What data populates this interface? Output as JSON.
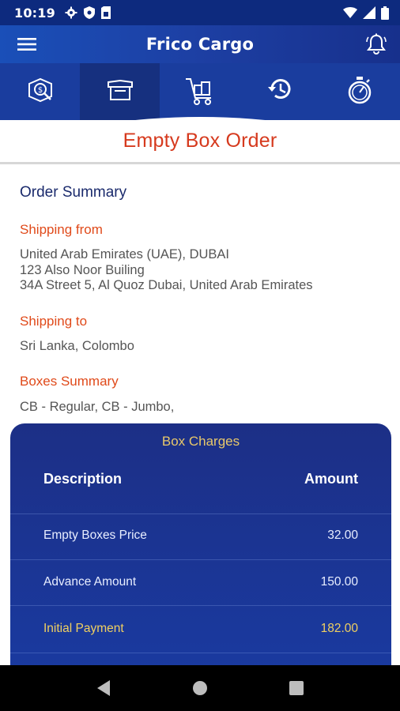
{
  "status_bar": {
    "time": "10:19",
    "icons": [
      "gear-icon",
      "shield-icon",
      "sim-card-icon",
      "wifi-icon",
      "signal-icon",
      "battery-icon"
    ]
  },
  "app_bar": {
    "title": "Frico Cargo",
    "menu_icon": "hamburger-menu-icon",
    "notification_icon": "bell-icon"
  },
  "tabs": [
    {
      "icon": "track-parcel-icon",
      "active": false
    },
    {
      "icon": "empty-box-icon",
      "active": true
    },
    {
      "icon": "cart-boxes-icon",
      "active": false
    },
    {
      "icon": "history-icon",
      "active": false
    },
    {
      "icon": "stopwatch-icon",
      "active": false
    }
  ],
  "page": {
    "title": "Empty Box Order"
  },
  "order_summary": {
    "heading": "Order Summary",
    "shipping_from_label": "Shipping from",
    "shipping_from_line1": "United Arab Emirates (UAE), DUBAI",
    "shipping_from_line2": "123 Also Noor Builing",
    "shipping_from_line3": "34A Street 5, Al Quoz Dubai, United Arab Emirates",
    "shipping_to_label": "Shipping to",
    "shipping_to_value": "Sri Lanka, Colombo",
    "boxes_summary_label": "Boxes Summary",
    "boxes_summary_value": "CB - Regular, CB - Jumbo,"
  },
  "box_charges": {
    "title": "Box Charges",
    "col_description": "Description",
    "col_amount": "Amount",
    "rows": [
      {
        "description": "Empty Boxes Price",
        "amount": "32.00",
        "highlight": false
      },
      {
        "description": "Advance Amount",
        "amount": "150.00",
        "highlight": false
      },
      {
        "description": "Initial Payment",
        "amount": "182.00",
        "highlight": true
      }
    ]
  },
  "colors": {
    "primary_blue": "#1a3d9e",
    "dark_blue": "#0d2a7e",
    "title_red": "#d63a1e",
    "label_orange": "#e04a1a",
    "highlight_yellow": "#f0d060",
    "card_title_gold": "#e8c86a"
  },
  "nav_bar": {
    "icons": [
      "back-icon",
      "home-icon",
      "recents-icon"
    ]
  }
}
